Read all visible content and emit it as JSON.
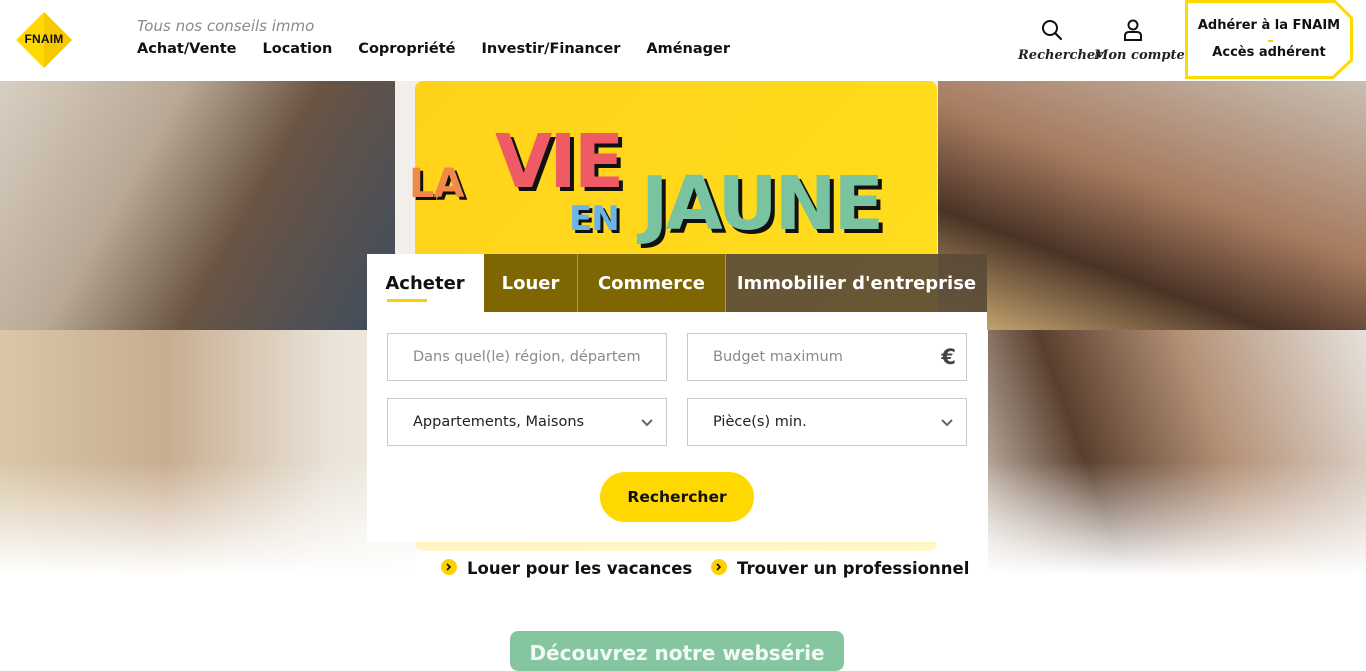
{
  "brand": {
    "logo_text": "FNAIM",
    "accent_color": "#ffd800"
  },
  "header": {
    "tagline": "Tous nos conseils immo",
    "nav": [
      "Achat/Vente",
      "Location",
      "Copropriété",
      "Investir/Financer",
      "Aménager"
    ],
    "search_label": "Rechercher",
    "account_label": "Mon compte",
    "member_join": "Adhérer à la FNAIM",
    "member_access": "Accès adhérent"
  },
  "hero": {
    "headline": {
      "la": "LA",
      "vie": "VIE",
      "en": "EN",
      "jaune": "JAUNE"
    }
  },
  "search": {
    "tabs": [
      "Acheter",
      "Louer",
      "Commerce",
      "Immobilier d'entreprise"
    ],
    "active_tab": "Acheter",
    "location_placeholder": "Dans quel(le) région, département, ville ?",
    "budget_placeholder": "Budget maximum",
    "currency_symbol": "€",
    "property_type_value": "Appartements, Maisons",
    "rooms_placeholder": "Pièce(s) min.",
    "submit_label": "Rechercher"
  },
  "links": {
    "vacation": "Louer pour les vacances",
    "professional": "Trouver un professionnel"
  },
  "bottom_button": {
    "label": "Découvrez notre websérie"
  }
}
